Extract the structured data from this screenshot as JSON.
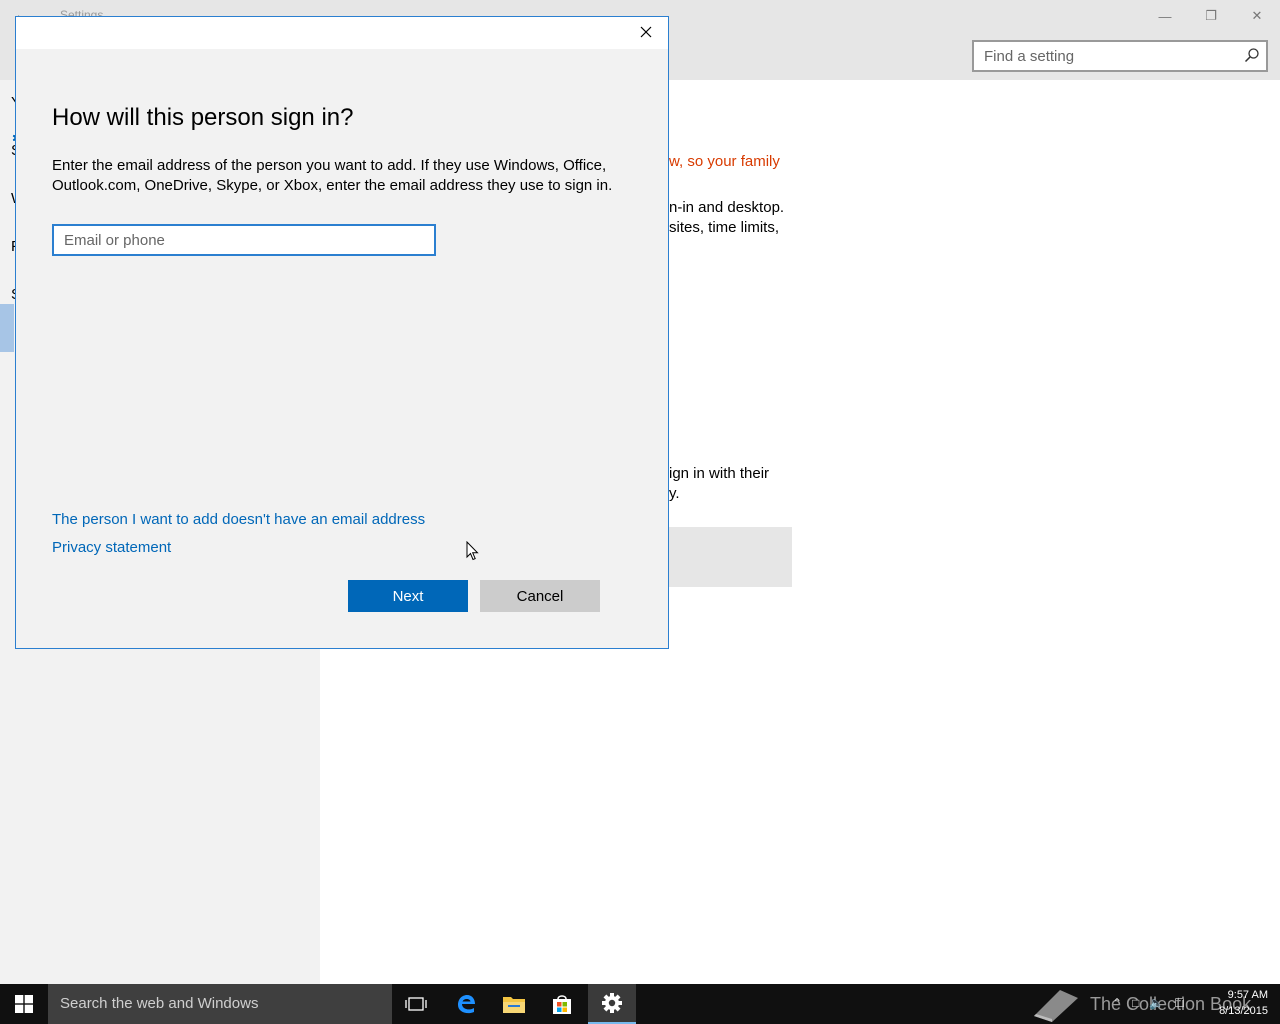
{
  "settings_window": {
    "title": "Settings",
    "search_placeholder": "Find a setting",
    "sidebar_letters": [
      "Y",
      "S",
      "W",
      "F",
      "S"
    ],
    "content_lines": [
      "w, so your family",
      "n-in and desktop.",
      "sites, time limits,",
      "ign in with their",
      "y."
    ]
  },
  "dialog": {
    "heading": "How will this person sign in?",
    "description": "Enter the email address of the person you want to add. If they use Windows, Office, Outlook.com, OneDrive, Skype, or Xbox, enter the email address they use to sign in.",
    "email_placeholder": "Email or phone",
    "no_email_link": "The person I want to add doesn't have an email address",
    "privacy_link": "Privacy statement",
    "next_label": "Next",
    "cancel_label": "Cancel"
  },
  "taskbar": {
    "search_text": "Search the web and Windows",
    "watermark": "The Collection Book",
    "time": "9:57 AM",
    "date": "8/13/2015"
  },
  "colors": {
    "accent": "#0067b8",
    "orange_text": "#d83b01",
    "dialog_border": "#2b7fd0"
  }
}
